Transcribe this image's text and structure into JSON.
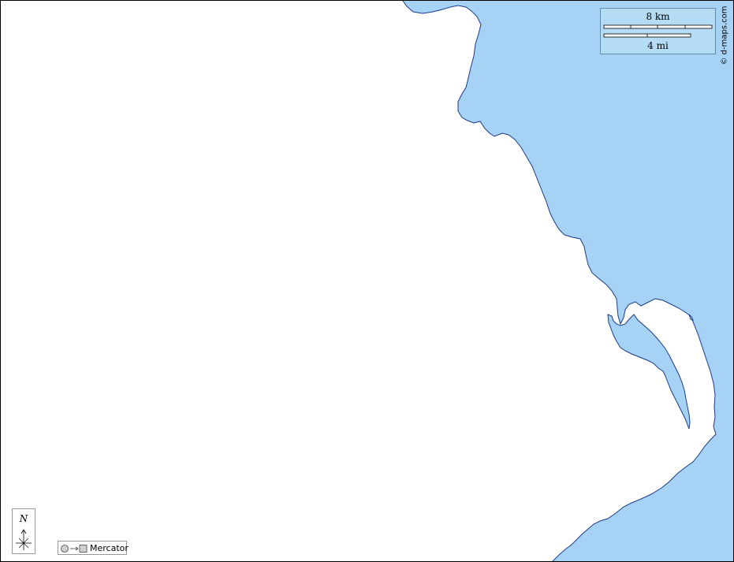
{
  "map": {
    "colors": {
      "land": "#ffffff",
      "water": "#a6d3f5",
      "coastline": "#1a3a8a",
      "frame": "#000000",
      "scale_box": "#b4dcf5"
    },
    "features": [
      "coastline",
      "sea",
      "coastal-lagoon"
    ]
  },
  "scale_bar": {
    "km_label": "8 km",
    "mi_label": "4 mi"
  },
  "credit": {
    "text": "© d-maps.com"
  },
  "compass": {
    "north_label": "N",
    "icon": "compass-rose-icon"
  },
  "projection": {
    "label": "Mercator",
    "icon": "globe-to-plane-icon"
  }
}
